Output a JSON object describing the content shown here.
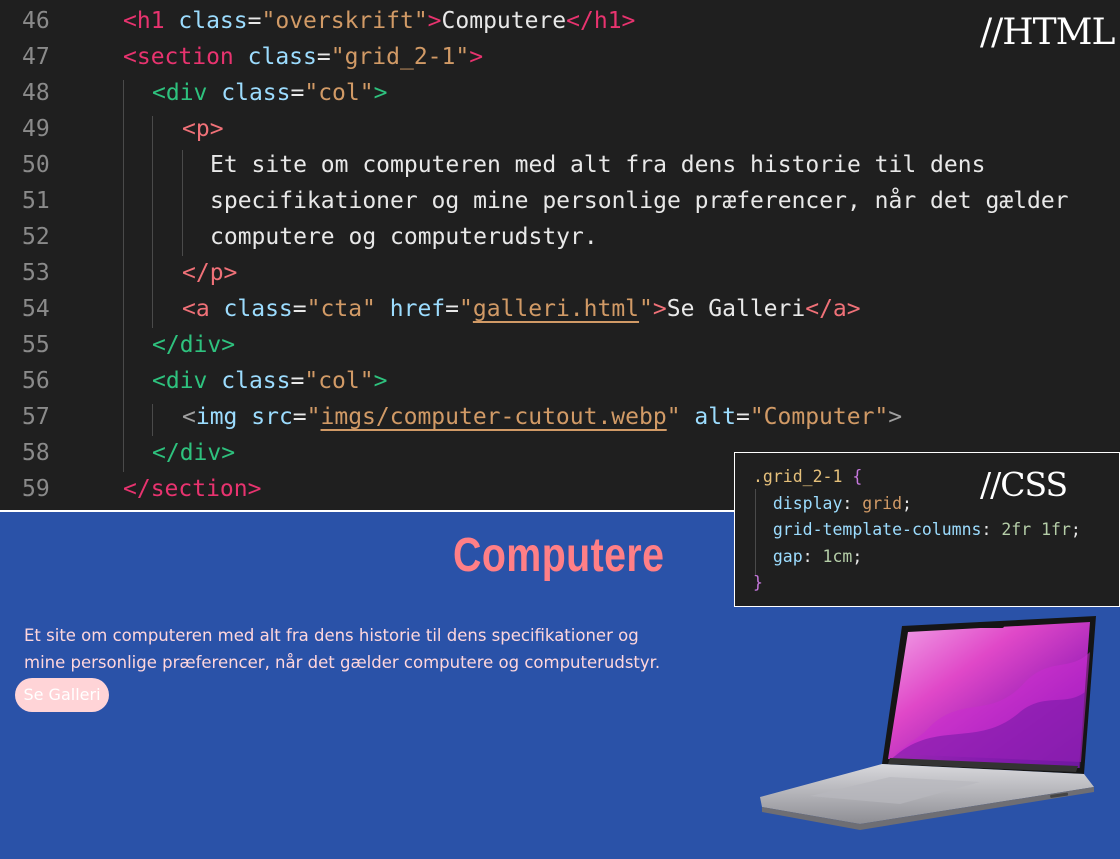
{
  "html_panel": {
    "label": "//HTML",
    "lines": [
      {
        "n": "46",
        "parts": [
          [
            "tag-pink",
            "<h1 "
          ],
          [
            "attr",
            "class"
          ],
          [
            "plain",
            "="
          ],
          [
            "str",
            "\"overskrift\""
          ],
          [
            "tag-pink",
            ">"
          ],
          [
            "plain",
            "Computere"
          ],
          [
            "tag-pink",
            "</h1>"
          ]
        ]
      },
      {
        "n": "47",
        "parts": [
          [
            "tag-pink",
            "<section "
          ],
          [
            "attr",
            "class"
          ],
          [
            "plain",
            "="
          ],
          [
            "str",
            "\"grid_2-1\""
          ],
          [
            "tag-pink",
            ">"
          ]
        ]
      },
      {
        "n": "48",
        "parts": [
          [
            "tag-green",
            "<div "
          ],
          [
            "attr",
            "class"
          ],
          [
            "plain",
            "="
          ],
          [
            "str",
            "\"col\""
          ],
          [
            "tag-green",
            ">"
          ]
        ]
      },
      {
        "n": "49",
        "parts": [
          [
            "tag-red",
            "<p>"
          ]
        ]
      },
      {
        "n": "50",
        "parts": [
          [
            "plain",
            "Et site om computeren med alt fra dens historie til dens"
          ]
        ]
      },
      {
        "n": "51",
        "parts": [
          [
            "plain",
            "specifikationer og mine personlige præferencer, når det gælder"
          ]
        ]
      },
      {
        "n": "52",
        "parts": [
          [
            "plain",
            "computere og computerudstyr."
          ]
        ]
      },
      {
        "n": "53",
        "parts": [
          [
            "tag-red",
            "</p>"
          ]
        ]
      },
      {
        "n": "54",
        "parts": [
          [
            "tag-red",
            "<a "
          ],
          [
            "attr",
            "class"
          ],
          [
            "plain",
            "="
          ],
          [
            "str",
            "\"cta\" "
          ],
          [
            "attr",
            "href"
          ],
          [
            "plain",
            "="
          ],
          [
            "str",
            "\""
          ],
          [
            "str-link",
            "galleri.html"
          ],
          [
            "str",
            "\""
          ],
          [
            "tag-red",
            ">"
          ],
          [
            "plain",
            "Se Galleri"
          ],
          [
            "tag-red",
            "</a>"
          ]
        ]
      },
      {
        "n": "55",
        "parts": [
          [
            "tag-green",
            "</div>"
          ]
        ]
      },
      {
        "n": "56",
        "parts": [
          [
            "tag-green",
            "<div "
          ],
          [
            "attr",
            "class"
          ],
          [
            "plain",
            "="
          ],
          [
            "str",
            "\"col\""
          ],
          [
            "tag-green",
            ">"
          ]
        ]
      },
      {
        "n": "57",
        "parts": [
          [
            "tag-grey",
            "<"
          ],
          [
            "attr",
            "img "
          ],
          [
            "attr",
            "src"
          ],
          [
            "plain",
            "="
          ],
          [
            "str",
            "\""
          ],
          [
            "str-link",
            "imgs/computer-cutout.webp"
          ],
          [
            "str",
            "\" "
          ],
          [
            "attr",
            "alt"
          ],
          [
            "plain",
            "="
          ],
          [
            "str",
            "\"Computer\""
          ],
          [
            "tag-grey",
            ">"
          ]
        ]
      },
      {
        "n": "58",
        "parts": [
          [
            "tag-green",
            "</div>"
          ]
        ]
      },
      {
        "n": "59",
        "parts": [
          [
            "tag-pink",
            "</section>"
          ]
        ]
      }
    ]
  },
  "css_panel": {
    "label": "//CSS",
    "lines": [
      [
        [
          "sel",
          ".grid_2-1 "
        ],
        [
          "brace",
          "{"
        ]
      ],
      [
        [
          "prop",
          "  display"
        ],
        [
          "plain",
          ": "
        ],
        [
          "val",
          "grid"
        ],
        [
          "plain",
          ";"
        ]
      ],
      [
        [
          "prop",
          "  grid-template-columns"
        ],
        [
          "plain",
          ": "
        ],
        [
          "num",
          "2fr 1fr"
        ],
        [
          "plain",
          ";"
        ]
      ],
      [
        [
          "prop",
          "  gap"
        ],
        [
          "plain",
          ": "
        ],
        [
          "num",
          "1cm"
        ],
        [
          "plain",
          ";"
        ]
      ],
      [
        [
          "brace",
          "}"
        ]
      ]
    ]
  },
  "preview": {
    "title": "Computere",
    "text": "Et site om computeren med alt fra dens historie til dens specifikationer og mine personlige præferencer, når det gælder computere og computerudstyr.",
    "cta_label": "Se Galleri",
    "image_alt": "Computer"
  },
  "colors": {
    "editor_bg": "#1f1f1f",
    "preview_bg": "#2a52a8",
    "title_color": "#ff7f86",
    "cta_bg": "#ffd4d7"
  }
}
